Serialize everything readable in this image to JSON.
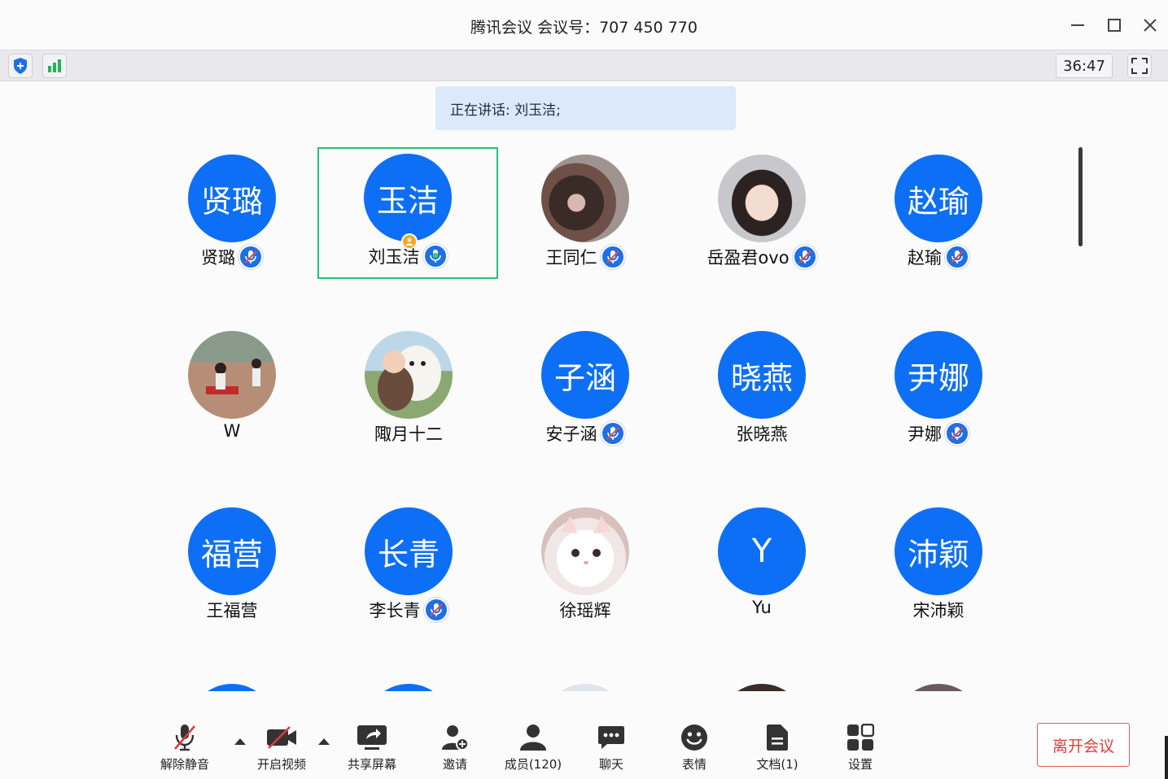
{
  "window": {
    "title": "腾讯会议 会议号：707 450 770",
    "minimize_label": "—",
    "maximize_label": "☐",
    "close_label": "✕"
  },
  "statusbar": {
    "security_icon": "shield-icon",
    "signal_icon": "signal-bars-icon",
    "timer": "36:47",
    "fullscreen_icon": "fullscreen-icon"
  },
  "speaking": {
    "text": "正在讲话: 刘玉洁;"
  },
  "colors": {
    "avatar_blue": "#0d6ff5",
    "active_border": "#27c07a",
    "leave_red": "#e03c3c",
    "speaking_bg": "#dbe9fb"
  },
  "participants": [
    {
      "avatar_text": "贤璐",
      "name": "贤璐",
      "avatar": "blue",
      "mic": "muted"
    },
    {
      "avatar_text": "玉洁",
      "name": "刘玉洁",
      "avatar": "blue",
      "mic": "speaking",
      "active": true,
      "host": true
    },
    {
      "avatar_text": "",
      "name": "王同仁",
      "avatar": "photo",
      "mic": "muted"
    },
    {
      "avatar_text": "",
      "name": "岳盈君ovo",
      "avatar": "anime",
      "mic": "muted"
    },
    {
      "avatar_text": "赵瑜",
      "name": "赵瑜",
      "avatar": "blue",
      "mic": "muted"
    },
    {
      "avatar_text": "",
      "name": "W",
      "avatar": "photo",
      "mic": "none"
    },
    {
      "avatar_text": "",
      "name": "陬月十二",
      "avatar": "illustration",
      "mic": "none"
    },
    {
      "avatar_text": "子涵",
      "name": "安子涵",
      "avatar": "blue",
      "mic": "muted"
    },
    {
      "avatar_text": "晓燕",
      "name": "张晓燕",
      "avatar": "blue",
      "mic": "none"
    },
    {
      "avatar_text": "尹娜",
      "name": "尹娜",
      "avatar": "blue",
      "mic": "muted"
    },
    {
      "avatar_text": "福营",
      "name": "王福营",
      "avatar": "blue",
      "mic": "none"
    },
    {
      "avatar_text": "长青",
      "name": "李长青",
      "avatar": "blue",
      "mic": "muted"
    },
    {
      "avatar_text": "",
      "name": "徐瑶辉",
      "avatar": "cat",
      "mic": "none"
    },
    {
      "avatar_text": "Y",
      "name": "Yu",
      "avatar": "blue",
      "mic": "none"
    },
    {
      "avatar_text": "沛颖",
      "name": "宋沛颖",
      "avatar": "blue",
      "mic": "none"
    }
  ],
  "toolbar": {
    "unmute": "解除静音",
    "start_video": "开启视频",
    "share_screen": "共享屏幕",
    "invite": "邀请",
    "members": "成员(120)",
    "chat": "聊天",
    "reactions": "表情",
    "docs": "文档(1)",
    "settings": "设置",
    "leave": "离开会议"
  }
}
